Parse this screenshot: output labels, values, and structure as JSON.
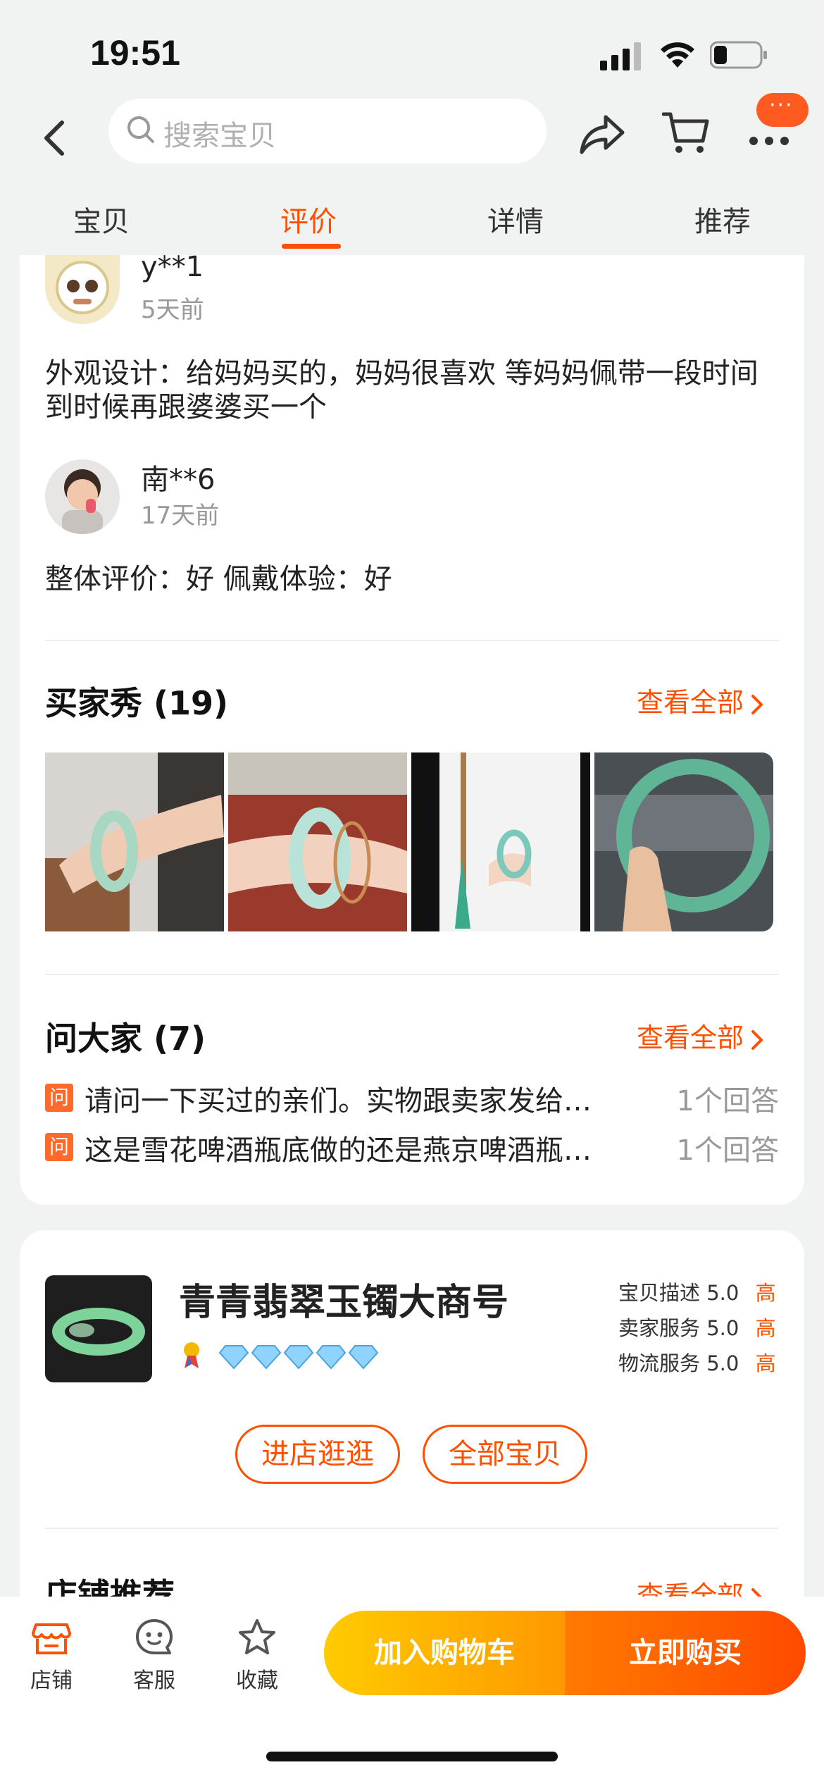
{
  "status_bar": {
    "time": "19:51"
  },
  "search": {
    "placeholder": "搜索宝贝"
  },
  "message_badge": "···",
  "tabs": [
    {
      "label": "宝贝",
      "active": false
    },
    {
      "label": "评价",
      "active": true
    },
    {
      "label": "详情",
      "active": false
    },
    {
      "label": "推荐",
      "active": false
    }
  ],
  "reviews": [
    {
      "user": "y**1",
      "time": "5天前",
      "text": "外观设计：给妈妈买的，妈妈很喜欢  等妈妈佩带一段时间到时候再跟婆婆买一个"
    },
    {
      "user": "南**6",
      "time": "17天前",
      "text": "整体评价：好 佩戴体验：好"
    }
  ],
  "buyer_show": {
    "title": "买家秀 (19)",
    "view_all": "查看全部"
  },
  "ask_all": {
    "title": "问大家 (7)",
    "view_all": "查看全部",
    "tag": "问",
    "items": [
      {
        "question": "请问一下买过的亲们。实物跟卖家发给…",
        "answers": "1个回答"
      },
      {
        "question": "这是雪花啤酒瓶底做的还是燕京啤酒瓶…",
        "answers": "1个回答"
      }
    ]
  },
  "store": {
    "name": "青青翡翠玉镯大商号",
    "ratings": [
      {
        "label": "宝贝描述",
        "score": "5.0",
        "level": "高"
      },
      {
        "label": "卖家服务",
        "score": "5.0",
        "level": "高"
      },
      {
        "label": "物流服务",
        "score": "5.0",
        "level": "高"
      }
    ],
    "enter_store": "进店逛逛",
    "all_items": "全部宝贝",
    "recommend_title": "店铺推荐",
    "recommend_view_all": "查看全部"
  },
  "bottom_bar": {
    "shop": "店铺",
    "service": "客服",
    "favorite": "收藏",
    "add_to_cart": "加入购物车",
    "buy_now": "立即购买"
  },
  "colors": {
    "accent": "#ff5000",
    "cart_gradient_start": "#ffcb00",
    "buy_gradient_end": "#ff4a00"
  }
}
